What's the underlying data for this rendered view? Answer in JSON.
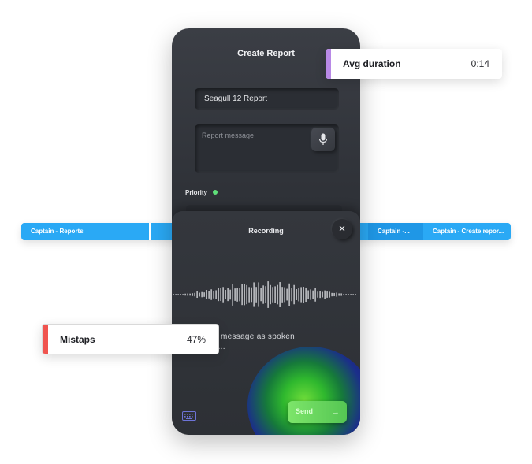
{
  "app": {
    "screen_title": "Create Report",
    "report_title_value": "Seagull 12 Report",
    "message_placeholder": "Report message",
    "priority_label": "Priority",
    "priority_color": "#5fe07a"
  },
  "recording": {
    "title": "Recording",
    "close_icon": "close-icon",
    "transcript_line1": "a report message as spoken",
    "transcript_line2": "Captain...",
    "send_label": "Send",
    "send_icon": "arrow-right-icon",
    "keyboard_icon": "keyboard-icon"
  },
  "timeline": {
    "color": "#2aa9f5",
    "segments": [
      {
        "label": "Captain - Reports"
      },
      {
        "label": ""
      },
      {
        "label": "Captain -..."
      },
      {
        "label": "Captain - Create repor..."
      }
    ]
  },
  "metrics": {
    "avg_duration": {
      "label": "Avg duration",
      "value": "0:14",
      "accent": "#b889e6"
    },
    "mistaps": {
      "label": "Mistaps",
      "value": "47%",
      "accent": "#f0544f"
    }
  }
}
